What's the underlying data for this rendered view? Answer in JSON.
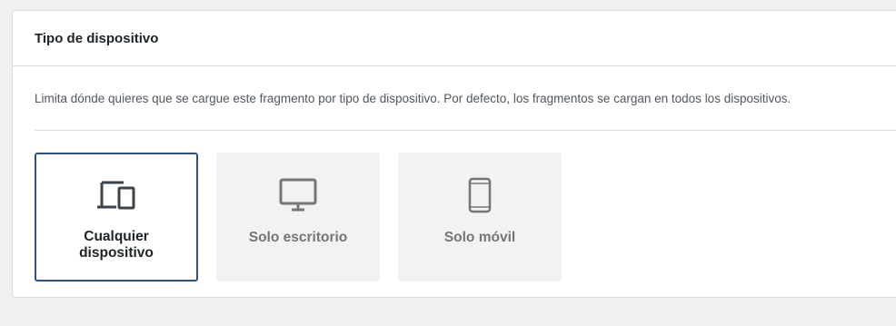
{
  "panel": {
    "title": "Tipo de dispositivo",
    "description": "Limita dónde quieres que se cargue este fragmento por tipo de dispositivo. Por defecto, los fragmentos se cargan en todos los dispositivos."
  },
  "device_options": [
    {
      "label": "Cualquier dispositivo",
      "icon": "devices-icon",
      "selected": true
    },
    {
      "label": "Solo escritorio",
      "icon": "desktop-icon",
      "selected": false
    },
    {
      "label": "Solo móvil",
      "icon": "mobile-icon",
      "selected": false
    }
  ],
  "colors": {
    "selected_border": "#2c4f86",
    "option_bg": "#f2f2f2",
    "icon_selected": "#3c434a",
    "icon_default": "#757575"
  }
}
